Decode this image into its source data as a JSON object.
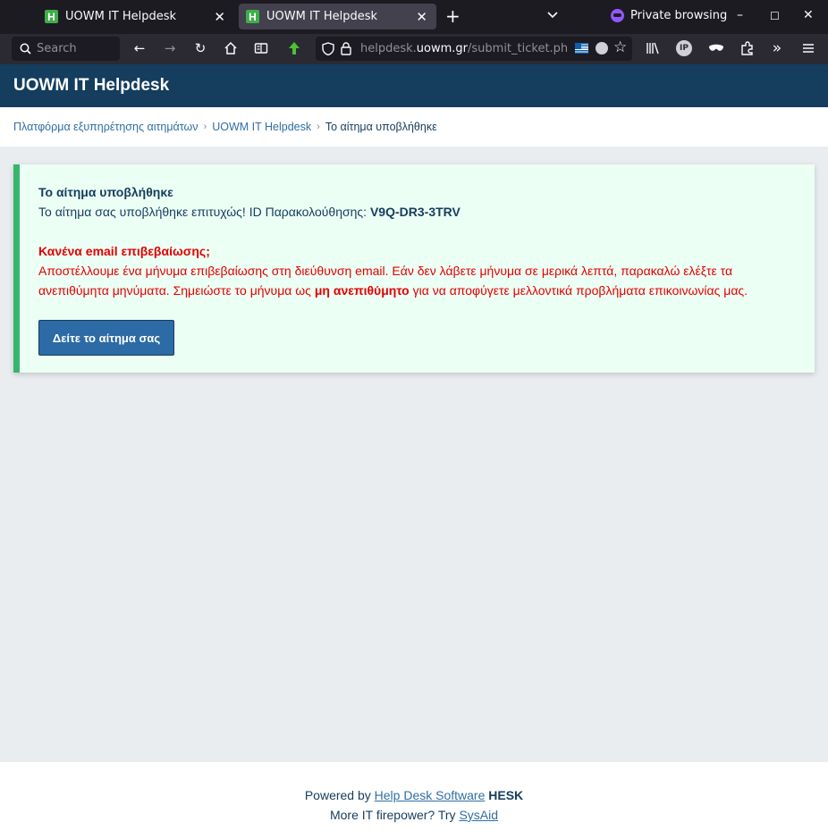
{
  "browser": {
    "tabs": [
      {
        "title": "UOWM IT Helpdesk",
        "favicon": "H"
      },
      {
        "title": "UOWM IT Helpdesk",
        "favicon": "H"
      }
    ],
    "private_label": "Private browsing",
    "search_placeholder": "Search",
    "url": {
      "prefix": "helpdesk.",
      "host": "uowm.gr",
      "path": "/submit_ticket.php?s"
    }
  },
  "site": {
    "title": "UOWM IT Helpdesk",
    "breadcrumbs": [
      "Πλατφόρμα εξυπηρέτησης αιτημάτων",
      "UOWM IT Helpdesk",
      "Το αίτημα υποβλήθηκε"
    ]
  },
  "notice": {
    "title": "Το αίτημα υποβλήθηκε",
    "success_text": "Το αίτημα σας υποβλήθηκε επιτυχώς! ID Παρακολούθησης:",
    "tracking_id": "V9Q-DR3-3TRV",
    "warning_title": "Κανένα email επιβεβαίωσης;",
    "warning_text_1": "Αποστέλλουμε ένα μήνυμα επιβεβαίωσης στη διεύθυνση email. Εάν δεν λάβετε μήνυμα σε μερικά λεπτά, παρακαλώ ελέξτε τα ανεπιθύμητα μηνύματα. Σημειώστε το μήνυμα ως",
    "warning_bold": "μη ανεπιθύμητο",
    "warning_text_2": "για να αποφύγετε μελλοντικά προβλήματα επικοινωνίας μας.",
    "button_label": "Δείτε το αίτημα σας"
  },
  "footer": {
    "powered_by": "Powered by",
    "link1": "Help Desk Software",
    "brand": "HESK",
    "more": "More IT firepower? Try",
    "link2": "SysAid"
  },
  "colors": {
    "header_bg": "#143d5e",
    "notice_bg": "#ecfff4",
    "notice_border": "#38b56d",
    "warning": "#e30000",
    "button_bg": "#2c6ba5"
  }
}
